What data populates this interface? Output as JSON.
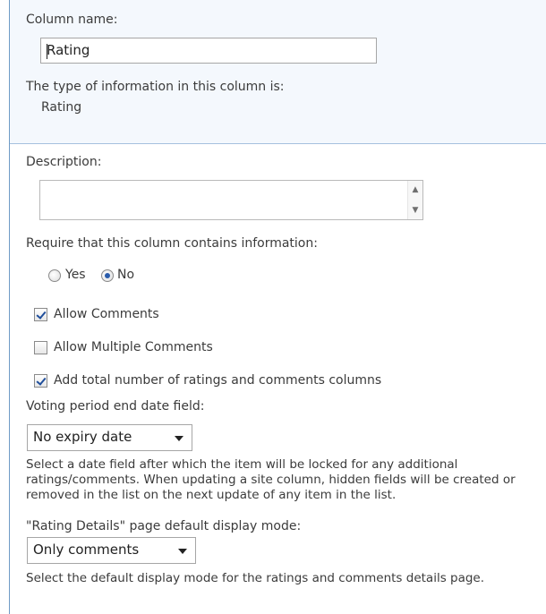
{
  "column_name": {
    "label": "Column name:",
    "value": "Rating"
  },
  "type_info": {
    "label": "The type of information in this column is:",
    "value": "Rating"
  },
  "description": {
    "label": "Description:",
    "value": "",
    "scroll_up_icon": "triangle-up",
    "scroll_down_icon": "triangle-down"
  },
  "require": {
    "label": "Require that this column contains information:",
    "options": [
      {
        "label": "Yes",
        "selected": false
      },
      {
        "label": "No",
        "selected": true
      }
    ]
  },
  "checkboxes": [
    {
      "label": "Allow Comments",
      "checked": true
    },
    {
      "label": "Allow Multiple Comments",
      "checked": false
    },
    {
      "label": "Add total number of ratings and comments columns",
      "checked": true
    }
  ],
  "voting_period": {
    "label": "Voting period end date field:",
    "selected": "No expiry date",
    "help": "Select a date field after which the item will be locked for any additional ratings/comments. When updating a site column, hidden fields will be created or removed in the list on the next update of any item in the list."
  },
  "rating_details": {
    "label": "\"Rating Details\" page default display mode:",
    "selected": "Only comments",
    "help": "Select the default display mode for the ratings and comments details page."
  },
  "colors": {
    "panel_border": "#6f9bc6",
    "top_section_bg": "#f4f8fd",
    "section_divider": "#a5c1de",
    "radio_selected": "#2a5cab",
    "check_mark": "#1f4e9b"
  }
}
